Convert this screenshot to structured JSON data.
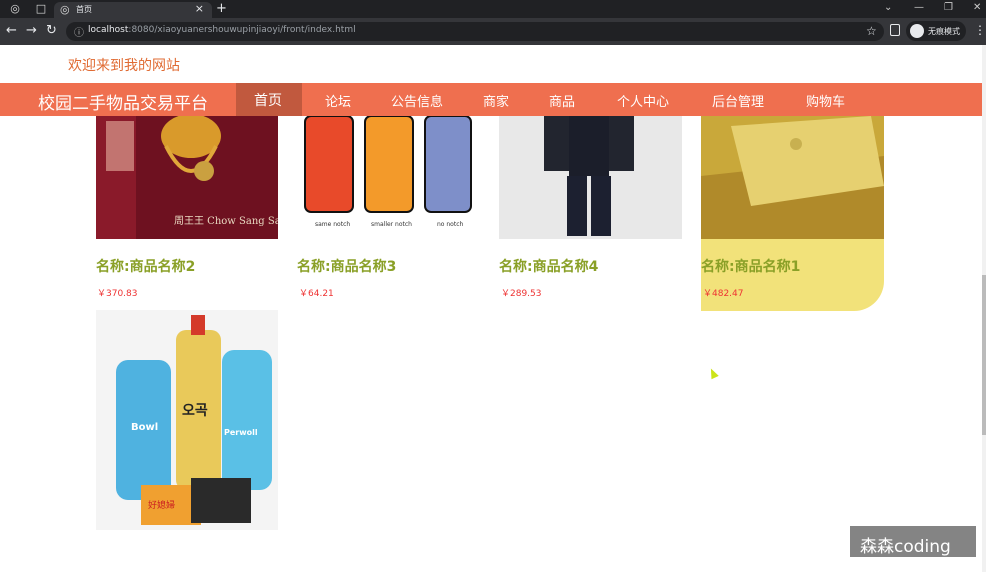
{
  "browser": {
    "tab_title": "首页",
    "url_host": "localhost",
    "url_rest": ":8080/xiaoyuanershouwupinjiaoyi/front/index.html",
    "incognito_label": "无痕模式"
  },
  "header": {
    "welcome": "欢迎来到我的网站",
    "brand": "校园二手物品交易平台"
  },
  "nav": {
    "items": [
      "首页",
      "论坛",
      "公告信息",
      "商家",
      "商品",
      "个人中心",
      "后台管理",
      "购物车"
    ],
    "active": "首页"
  },
  "products": [
    {
      "name": "名称:商品名称2",
      "price": "￥370.83",
      "image": "gold-jewelry",
      "image_text": "周王王 Chow Sang Sang"
    },
    {
      "name": "名称:商品名称3",
      "price": "￥64.21",
      "image": "phone-cases",
      "notch_labels": [
        "same notch",
        "smaller notch",
        "no notch"
      ]
    },
    {
      "name": "名称:商品名称4",
      "price": "￥289.53",
      "image": "black-tracksuit"
    },
    {
      "name": "名称:商品名称1",
      "price": "￥482.47",
      "image": "laptop-on-wood"
    },
    {
      "name": "",
      "price": "",
      "image": "detergent-bottles",
      "image_text": [
        "Bowl",
        "오곡",
        "Perwoll",
        "好媳婦"
      ]
    }
  ],
  "watermark": "森森coding",
  "colors": {
    "nav_bg": "#ef6f4f",
    "nav_active": "#c1593e",
    "product_name": "#8aa027",
    "price": "#e33333",
    "welcome": "#e06b33"
  }
}
